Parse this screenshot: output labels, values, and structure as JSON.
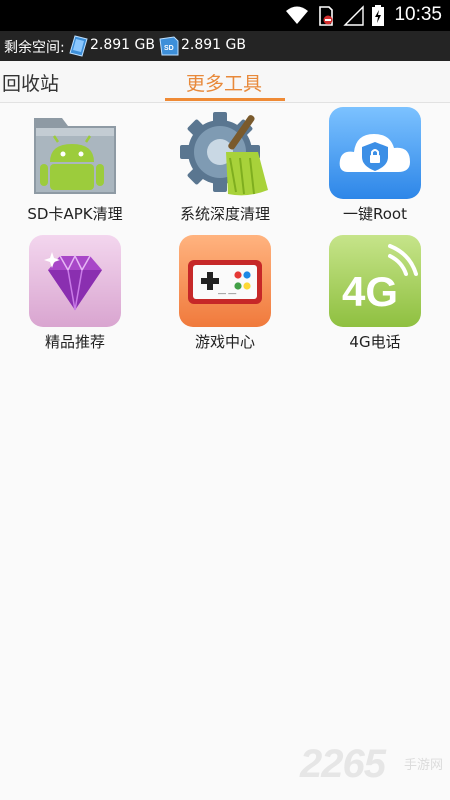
{
  "status_bar": {
    "time": "10:35"
  },
  "storage": {
    "label": "剩余空间:",
    "internal_value": "2.891 GB",
    "sd_value": "2.891 GB",
    "sd_icon_text": "SD"
  },
  "tabs": [
    {
      "label": "回收站",
      "selected": false
    },
    {
      "label": "更多工具",
      "selected": true
    }
  ],
  "colors": {
    "accent": "#ef8a35",
    "storage_bg": "#242424",
    "status_bg": "#000000"
  },
  "tools": [
    {
      "label": "SD卡APK清理",
      "icon": "android-folder-icon"
    },
    {
      "label": "系统深度清理",
      "icon": "gear-broom-icon"
    },
    {
      "label": "一键Root",
      "icon": "cloud-lock-icon"
    },
    {
      "label": "精品推荐",
      "icon": "diamond-icon"
    },
    {
      "label": "游戏中心",
      "icon": "gamepad-icon",
      "icon_text": "— —"
    },
    {
      "label": "4G电话",
      "icon": "4g-signal-icon",
      "icon_text": "4G"
    }
  ],
  "watermark": {
    "number": "2265",
    "sub": "手游网"
  }
}
